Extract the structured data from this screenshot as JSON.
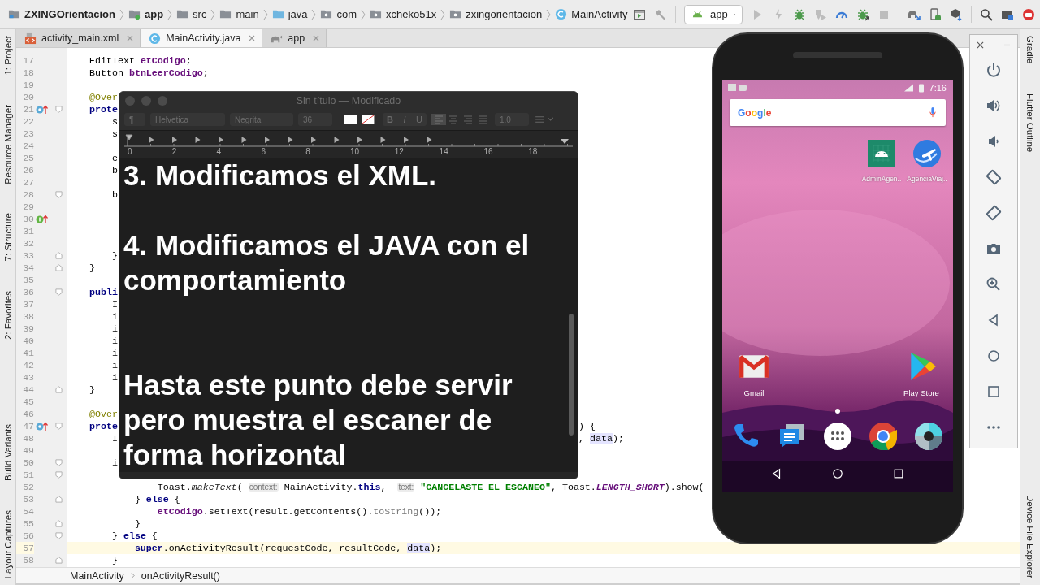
{
  "ide": {
    "nav": [
      {
        "label": "ZXINGOrientacion",
        "kind": "project"
      },
      {
        "label": "app",
        "kind": "module"
      },
      {
        "label": "src",
        "kind": "folder"
      },
      {
        "label": "main",
        "kind": "folder"
      },
      {
        "label": "java",
        "kind": "source"
      },
      {
        "label": "com",
        "kind": "package"
      },
      {
        "label": "xcheko51x",
        "kind": "package"
      },
      {
        "label": "zxingorientacion",
        "kind": "package"
      },
      {
        "label": "MainActivity",
        "kind": "class"
      }
    ],
    "run_config": "app",
    "tabs": [
      {
        "label": "activity_main.xml",
        "kind": "xml",
        "selected": false
      },
      {
        "label": "MainActivity.java",
        "kind": "class",
        "selected": true
      },
      {
        "label": "app",
        "kind": "gradle",
        "selected": false
      }
    ],
    "left_tools_top": [
      "1: Project",
      "Resource Manager",
      "7: Structure",
      "2: Favorites"
    ],
    "left_tools_bottom": [
      "Build Variants",
      "Layout Captures"
    ],
    "right_tools_top": [
      "Gradle",
      "Flutter Outline"
    ],
    "right_tools_bottom": [
      "Device File Explorer"
    ],
    "lines": [
      {
        "number": "17",
        "current": false,
        "code": [
          {
            "text": "EditText ",
            "kind": "plain"
          },
          {
            "text": "etCodigo",
            "kind": "field"
          },
          {
            "text": ";",
            "kind": "plain"
          }
        ]
      },
      {
        "number": "18",
        "current": false,
        "code": [
          {
            "text": "Button ",
            "kind": "plain"
          },
          {
            "text": "btnLeerCodigo",
            "kind": "field"
          },
          {
            "text": ";",
            "kind": "plain"
          }
        ]
      },
      {
        "number": "19",
        "current": false
      },
      {
        "number": "20",
        "current": false,
        "code": [
          {
            "text": "@Over",
            "kind": "anno"
          }
        ]
      },
      {
        "number": "21",
        "current": false,
        "gutter": {
          "kind": "override"
        },
        "fold": {
          "kind": "start"
        },
        "code": [
          {
            "text": "prote",
            "kind": "kw"
          }
        ]
      },
      {
        "number": "22",
        "current": false,
        "code": [
          {
            "text": "    s",
            "kind": "plain"
          }
        ]
      },
      {
        "number": "23",
        "current": false,
        "code": [
          {
            "text": "    s",
            "kind": "plain"
          }
        ]
      },
      {
        "number": "24",
        "current": false
      },
      {
        "number": "25",
        "current": false,
        "code": [
          {
            "text": "    e",
            "kind": "plain"
          }
        ]
      },
      {
        "number": "26",
        "current": false,
        "code": [
          {
            "text": "    b",
            "kind": "plain"
          }
        ]
      },
      {
        "number": "27",
        "current": false
      },
      {
        "number": "28",
        "current": false,
        "fold": {
          "kind": "start"
        },
        "code": [
          {
            "text": "    b",
            "kind": "plain"
          }
        ]
      },
      {
        "number": "29",
        "current": false
      },
      {
        "number": "30",
        "current": false,
        "gutter": {
          "kind": "implement"
        }
      },
      {
        "number": "31",
        "current": false
      },
      {
        "number": "32",
        "current": false
      },
      {
        "number": "33",
        "current": false,
        "fold": {
          "kind": "end"
        },
        "code": [
          {
            "text": "    }",
            "kind": "plain"
          }
        ]
      },
      {
        "number": "34",
        "current": false,
        "fold": {
          "kind": "end"
        },
        "code": [
          {
            "text": "}",
            "kind": "plain"
          }
        ]
      },
      {
        "number": "35",
        "current": false
      },
      {
        "number": "36",
        "current": false,
        "fold": {
          "kind": "start"
        },
        "code": [
          {
            "text": "publi",
            "kind": "kw"
          }
        ]
      },
      {
        "number": "37",
        "current": false,
        "code": [
          {
            "text": "    I",
            "kind": "plain"
          }
        ]
      },
      {
        "number": "38",
        "current": false,
        "code": [
          {
            "text": "    i",
            "kind": "plain"
          }
        ]
      },
      {
        "number": "39",
        "current": false,
        "code": [
          {
            "text": "    i",
            "kind": "plain"
          }
        ]
      },
      {
        "number": "40",
        "current": false,
        "code": [
          {
            "text": "    i",
            "kind": "plain"
          }
        ]
      },
      {
        "number": "41",
        "current": false,
        "code": [
          {
            "text": "    i",
            "kind": "plain"
          }
        ]
      },
      {
        "number": "42",
        "current": false,
        "code": [
          {
            "text": "    i",
            "kind": "plain"
          }
        ]
      },
      {
        "number": "43",
        "current": false,
        "code": [
          {
            "text": "    i",
            "kind": "plain"
          }
        ]
      },
      {
        "number": "44",
        "current": false,
        "fold": {
          "kind": "end"
        },
        "code": [
          {
            "text": "}",
            "kind": "plain"
          }
        ]
      },
      {
        "number": "45",
        "current": false
      },
      {
        "number": "46",
        "current": false,
        "code": [
          {
            "text": "@Over",
            "kind": "anno"
          }
        ]
      },
      {
        "number": "47",
        "current": false,
        "gutter": {
          "kind": "override"
        },
        "fold": {
          "kind": "start"
        },
        "code": [
          {
            "text": "prote",
            "kind": "kw"
          }
        ],
        "right": [
          {
            "text": ") {",
            "kind": "plain"
          }
        ]
      },
      {
        "number": "48",
        "current": false,
        "code": [
          {
            "text": "    I",
            "kind": "plain"
          }
        ],
        "right": [
          {
            "text": ", ",
            "kind": "plain"
          },
          {
            "text": "data",
            "kind": "param"
          },
          {
            "text": ");",
            "kind": "plain"
          }
        ]
      },
      {
        "number": "49",
        "current": false
      },
      {
        "number": "50",
        "current": false,
        "fold": {
          "kind": "start"
        },
        "code": [
          {
            "text": "    i",
            "kind": "plain"
          }
        ]
      },
      {
        "number": "51",
        "current": false,
        "fold": {
          "kind": "start"
        }
      },
      {
        "number": "52",
        "current": false,
        "code": [
          {
            "text": "            Toast.",
            "kind": "plain"
          },
          {
            "text": "makeText",
            "kind": "static_call"
          },
          {
            "text": "( ",
            "kind": "plain"
          },
          {
            "text": "context:",
            "kind": "hint"
          },
          {
            "text": " MainActivity.",
            "kind": "plain"
          },
          {
            "text": "this",
            "kind": "kw"
          },
          {
            "text": ",  ",
            "kind": "plain"
          },
          {
            "text": "text:",
            "kind": "hint"
          },
          {
            "text": " \"CANCELASTE EL ESCANEO\"",
            "kind": "str"
          },
          {
            "text": ", Toast.",
            "kind": "plain"
          },
          {
            "text": "LENGTH_SHORT",
            "kind": "const"
          },
          {
            "text": ").show(",
            "kind": "plain"
          }
        ]
      },
      {
        "number": "53",
        "current": false,
        "fold": {
          "kind": "end"
        },
        "code": [
          {
            "text": "        } ",
            "kind": "plain"
          },
          {
            "text": "else",
            "kind": "kw"
          },
          {
            "text": " {",
            "kind": "plain"
          }
        ]
      },
      {
        "number": "54",
        "current": false,
        "code": [
          {
            "text": "            etCodigo",
            "kind": "field"
          },
          {
            "text": ".setText(result.getContents().",
            "kind": "plain"
          },
          {
            "text": "toString",
            "kind": "inherited"
          },
          {
            "text": "());",
            "kind": "plain"
          }
        ]
      },
      {
        "number": "55",
        "current": false,
        "fold": {
          "kind": "end"
        },
        "code": [
          {
            "text": "        }",
            "kind": "plain"
          }
        ]
      },
      {
        "number": "56",
        "current": false,
        "fold": {
          "kind": "start"
        },
        "code": [
          {
            "text": "    } ",
            "kind": "plain"
          },
          {
            "text": "else",
            "kind": "kw"
          },
          {
            "text": " {",
            "kind": "plain"
          }
        ]
      },
      {
        "number": "57",
        "current": true,
        "code": [
          {
            "text": "        super",
            "kind": "kw"
          },
          {
            "text": ".onActivityResult(requestCode, resultCode, ",
            "kind": "plain"
          },
          {
            "text": "data",
            "kind": "param"
          },
          {
            "text": ");",
            "kind": "plain"
          }
        ]
      },
      {
        "number": "58",
        "current": false,
        "fold": {
          "kind": "end"
        },
        "code": [
          {
            "text": "    }",
            "kind": "plain"
          }
        ]
      }
    ],
    "breadcrumb": [
      "MainActivity",
      "onActivityResult()"
    ]
  },
  "textedit": {
    "title": "Sin título — Modificado",
    "paragraph_style": "¶",
    "font": "Helvetica",
    "typeface": "Negrita",
    "size": "36",
    "bold": "B",
    "italic": "I",
    "underline": "U",
    "spacing": "1.0",
    "ruler": [
      "0",
      "2",
      "4",
      "6",
      "8",
      "10",
      "12",
      "14",
      "16",
      "18"
    ],
    "paragraphs": [
      {
        "text": "3. Modificamos el XML.",
        "kind": "step"
      },
      {
        "text": "4. Modificamos el JAVA con el comportamiento",
        "kind": "step"
      },
      {
        "text": "Hasta este punto debe servir pero muestra el escaner de forma horizontal",
        "kind": "note"
      }
    ]
  },
  "emulator": {
    "time": "7:16",
    "search_logo": "Google",
    "apps": [
      {
        "label": "AdminAgen..",
        "kind": "android"
      },
      {
        "label": "AgenciaViaj..",
        "kind": "plane"
      }
    ],
    "favorites": [
      {
        "label": "Gmail",
        "kind": "gmail"
      },
      {
        "label": "Play Store",
        "kind": "play"
      }
    ],
    "dock": [
      {
        "kind": "phone"
      },
      {
        "kind": "messages"
      },
      {
        "kind": "apps"
      },
      {
        "kind": "chrome"
      },
      {
        "kind": "camera"
      }
    ]
  }
}
